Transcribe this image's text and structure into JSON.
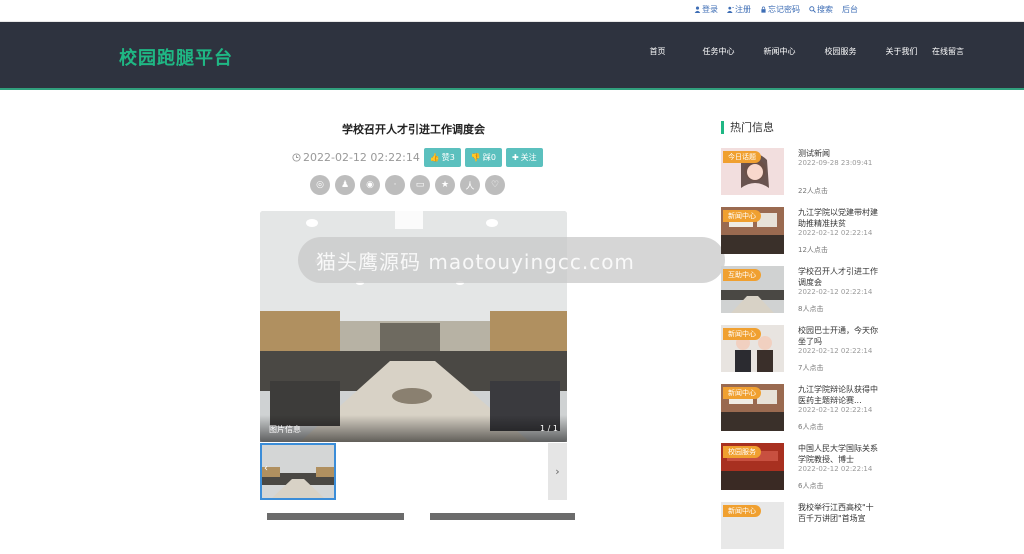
{
  "topbar": {
    "links": [
      {
        "label": "登录",
        "icon": "user-icon"
      },
      {
        "label": "注册",
        "icon": "user-plus-icon"
      },
      {
        "label": "忘记密码",
        "icon": "lock-icon"
      },
      {
        "label": "搜索",
        "icon": "search-icon"
      },
      {
        "label": "后台",
        "icon": ""
      }
    ]
  },
  "header": {
    "logo": "校园跑腿平台",
    "nav": [
      "首页",
      "任务中心",
      "新闻中心",
      "校园服务",
      "关于我们",
      "在线留言"
    ]
  },
  "article": {
    "title": "学校召开人才引进工作调度会",
    "date": "2022-02-12 02:22:14",
    "like_label": "赞3",
    "dislike_label": "踩0",
    "follow_label": "关注",
    "share_icons": [
      "weibo-icon",
      "qq-icon",
      "wechat-icon",
      "douban-icon",
      "qzone-icon",
      "star-icon",
      "renren-icon",
      "tieba-icon"
    ],
    "photo_info_label": "图片信息",
    "photo_count": "1 / 1"
  },
  "watermark": "猫头鹰源码 maotouyingcc.com",
  "sidebar": {
    "title": "热门信息",
    "items": [
      {
        "tag": "今日话题",
        "title": "测试新闻",
        "date": "2022-09-28 23:09:41",
        "clicks": "22人点击"
      },
      {
        "tag": "新闻中心",
        "title": "九江学院以党建带村建助推精准扶贫",
        "date": "2022-02-12 02:22:14",
        "clicks": "12人点击"
      },
      {
        "tag": "互助中心",
        "title": "学校召开人才引进工作调度会",
        "date": "2022-02-12 02:22:14",
        "clicks": "8人点击"
      },
      {
        "tag": "新闻中心",
        "title": "校园巴士开通，今天你坐了吗",
        "date": "2022-02-12 02:22:14",
        "clicks": "7人点击"
      },
      {
        "tag": "新闻中心",
        "title": "九江学院辩论队获得中医药主题辩论赛...",
        "date": "2022-02-12 02:22:14",
        "clicks": "6人点击"
      },
      {
        "tag": "校园服务",
        "title": "中国人民大学国际关系学院教授、博士",
        "date": "2022-02-12 02:22:14",
        "clicks": "6人点击"
      },
      {
        "tag": "新闻中心",
        "title": "我校举行江西高校\"十百千万讲团\"首场宣",
        "date": "",
        "clicks": ""
      }
    ]
  }
}
